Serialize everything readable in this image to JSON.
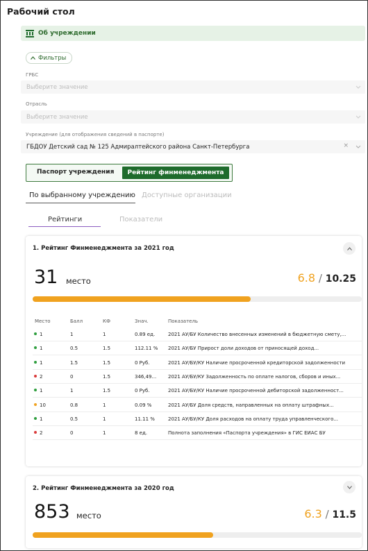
{
  "page": {
    "title": "Рабочий стол"
  },
  "about": {
    "label": "Об учреждении"
  },
  "filters": {
    "toggle_label": "Фильтры",
    "grbs": {
      "label": "ГРБС",
      "placeholder": "Выберите значение"
    },
    "otrasl": {
      "label": "Отрасль",
      "placeholder": "Выберите значение"
    },
    "institution": {
      "label": "Учреждение (для отображения сведений в паспорте)",
      "value": "ГБДОУ Детский сад № 125 Адмиралтейского района Санкт-Петербурга",
      "clear": "×"
    }
  },
  "segment": {
    "passport": "Паспорт учреждения",
    "rating": "Рейтинг финменеджмента"
  },
  "tabs_primary": [
    {
      "label": "По выбранному учреждению"
    },
    {
      "label": "Доступные организации"
    }
  ],
  "tabs_secondary": [
    {
      "label": "Рейтинги"
    },
    {
      "label": "Показатели"
    }
  ],
  "colors": {
    "green": "#2e9e3e",
    "red": "#d93a3a",
    "orange": "#f0a21f",
    "accent": "#1e6b2c"
  },
  "rating2021": {
    "title": "1. Рейтинг Финменеджмента за 2021 год",
    "place": "31",
    "place_label": "место",
    "score": "6.8",
    "sep": "/",
    "max": "10.25",
    "progress": 0.663,
    "columns": [
      "Место",
      "Балл",
      "КФ",
      "Знач.",
      "Показатель"
    ],
    "rows": [
      {
        "status": "green",
        "place": "1",
        "score": "1",
        "kf": "1",
        "value": "0.89 ед.",
        "indicator": "2021 АУ/БУ Количество внесенных изменений в бюджетную смету,..."
      },
      {
        "status": "green",
        "place": "1",
        "score": "0.5",
        "kf": "1.5",
        "value": "112.11 %",
        "indicator": "2021 АУ/БУ Прирост доли доходов от приносящей доход..."
      },
      {
        "status": "green",
        "place": "1",
        "score": "1.5",
        "kf": "1.5",
        "value": "0 Руб.",
        "indicator": "2021 АУ/БУ/КУ Наличие просроченной кредиторской задолженности"
      },
      {
        "status": "red",
        "place": "2",
        "score": "0",
        "kf": "1.5",
        "value": "346,49...",
        "indicator": "2021 АУ/БУ/КУ Задолженность по оплате налогов, сборов и иных..."
      },
      {
        "status": "green",
        "place": "1",
        "score": "1",
        "kf": "1.5",
        "value": "0 Руб.",
        "indicator": "2021 АУ/БУ/КУ Наличие просроченной дебиторской задолженност..."
      },
      {
        "status": "orange",
        "place": "10",
        "score": "0.8",
        "kf": "1",
        "value": "0.09 %",
        "indicator": "2021 АУ/БУ Доля средств, направленных на оплату штрафных..."
      },
      {
        "status": "green",
        "place": "1",
        "score": "0.5",
        "kf": "1",
        "value": "11.11 %",
        "indicator": "2021 АУ/БУ/КУ Доля расходов на оплату труда управленческого..."
      },
      {
        "status": "red",
        "place": "2",
        "score": "0",
        "kf": "1",
        "value": "8 ед.",
        "indicator": "Полнота заполнения «Паспорта учреждения» в ГИС ЕИАС БУ"
      }
    ]
  },
  "rating2020": {
    "title": "2. Рейтинг Финменеджмента за 2020 год",
    "place": "853",
    "place_label": "место",
    "score": "6.3",
    "sep": "/",
    "max": "11.5",
    "progress": 0.548
  }
}
